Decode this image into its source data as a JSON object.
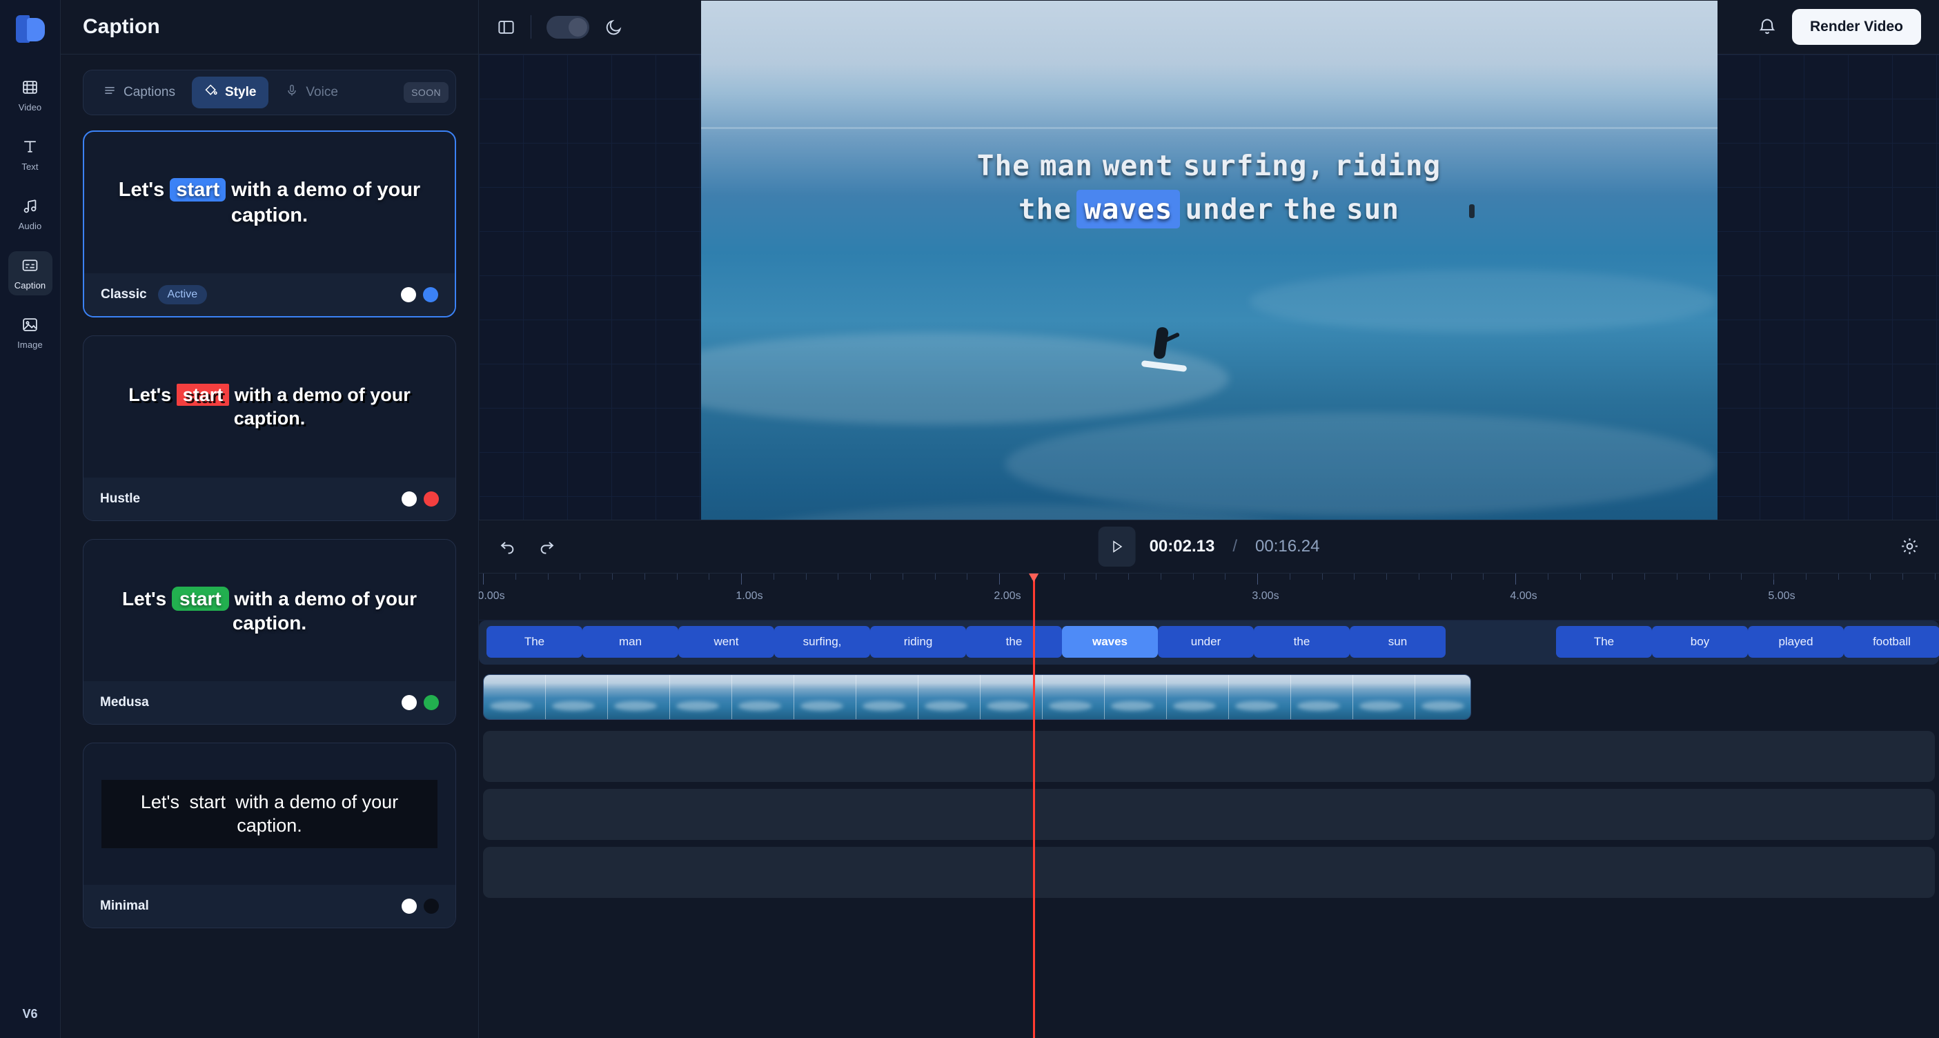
{
  "rail": {
    "logo_name": "app-logo",
    "version": "V6",
    "items": [
      {
        "label": "Video",
        "icon": "film-icon",
        "active": false
      },
      {
        "label": "Text",
        "icon": "text-icon",
        "active": false
      },
      {
        "label": "Audio",
        "icon": "music-note-icon",
        "active": false
      },
      {
        "label": "Caption",
        "icon": "caption-icon",
        "active": true
      },
      {
        "label": "Image",
        "icon": "image-icon",
        "active": false
      }
    ]
  },
  "panel": {
    "title": "Caption",
    "tabs": [
      {
        "label": "Captions",
        "icon": "list-icon",
        "active": false
      },
      {
        "label": "Style",
        "icon": "paint-bucket-icon",
        "active": true
      },
      {
        "label": "Voice",
        "icon": "microphone-icon",
        "active": false
      }
    ],
    "soon_badge": "SOON",
    "styles": [
      {
        "name": "Classic",
        "badge": "Active",
        "selected": true,
        "preview": {
          "pre": "Let's ",
          "highlight": "start",
          "post": " with a demo of your caption."
        },
        "colors": {
          "text": "#ffffff",
          "highlight": "#3b82f6"
        }
      },
      {
        "name": "Hustle",
        "badge": "",
        "selected": false,
        "preview": {
          "pre": "Let's ",
          "highlight": "start",
          "post": " with a demo of your caption."
        },
        "colors": {
          "text": "#ffffff",
          "highlight": "#f43f3f"
        }
      },
      {
        "name": "Medusa",
        "badge": "",
        "selected": false,
        "preview": {
          "pre": "Let's ",
          "highlight": "start",
          "post": " with a demo of your caption."
        },
        "colors": {
          "text": "#ffffff",
          "highlight": "#22b04f"
        }
      },
      {
        "name": "Minimal",
        "badge": "",
        "selected": false,
        "preview": {
          "pre": "Let's ",
          "highlight": "start",
          "post": " with a demo of your caption."
        },
        "colors": {
          "text": "#ffffff",
          "highlight": "#0b0f18"
        }
      }
    ]
  },
  "topbar": {
    "sidebar_toggle_icon": "panel-left-icon",
    "theme_toggle_state": "on",
    "theme_icon": "moon-icon",
    "bell_icon": "bell-icon",
    "render_label": "Render Video"
  },
  "preview": {
    "caption_lines": [
      {
        "words": [
          {
            "t": "The",
            "hl": false
          },
          {
            "t": "man",
            "hl": false
          },
          {
            "t": "went",
            "hl": false
          },
          {
            "t": "surfing,",
            "hl": false
          },
          {
            "t": "riding",
            "hl": false
          }
        ]
      },
      {
        "words": [
          {
            "t": "the",
            "hl": false
          },
          {
            "t": "waves",
            "hl": true
          },
          {
            "t": "under",
            "hl": false
          },
          {
            "t": "the",
            "hl": false
          },
          {
            "t": "sun",
            "hl": false
          }
        ]
      }
    ],
    "highlight_color": "#4a86f0"
  },
  "transport": {
    "undo_icon": "undo-icon",
    "redo_icon": "redo-icon",
    "play_icon": "play-icon",
    "current_time": "00:02.13",
    "separator": "/",
    "total_time": "00:16.24",
    "settings_icon": "gear-icon"
  },
  "timeline": {
    "ruler_labels": [
      "0.00s",
      "1.00s",
      "2.00s",
      "3.00s",
      "4.00s",
      "5.00s"
    ],
    "playhead_time": "00:02.13",
    "playhead_color": "#ff3b30",
    "caption_chips": [
      {
        "text": "The",
        "selected": false
      },
      {
        "text": "man",
        "selected": false
      },
      {
        "text": "went",
        "selected": false
      },
      {
        "text": "surfing,",
        "selected": false
      },
      {
        "text": "riding",
        "selected": false
      },
      {
        "text": "the",
        "selected": false
      },
      {
        "text": "waves",
        "selected": true
      },
      {
        "text": "under",
        "selected": false
      },
      {
        "text": "the",
        "selected": false
      },
      {
        "text": "sun",
        "selected": false
      },
      {
        "text": "The",
        "selected": false
      },
      {
        "text": "boy",
        "selected": false
      },
      {
        "text": "played",
        "selected": false
      },
      {
        "text": "football",
        "selected": false
      }
    ]
  }
}
